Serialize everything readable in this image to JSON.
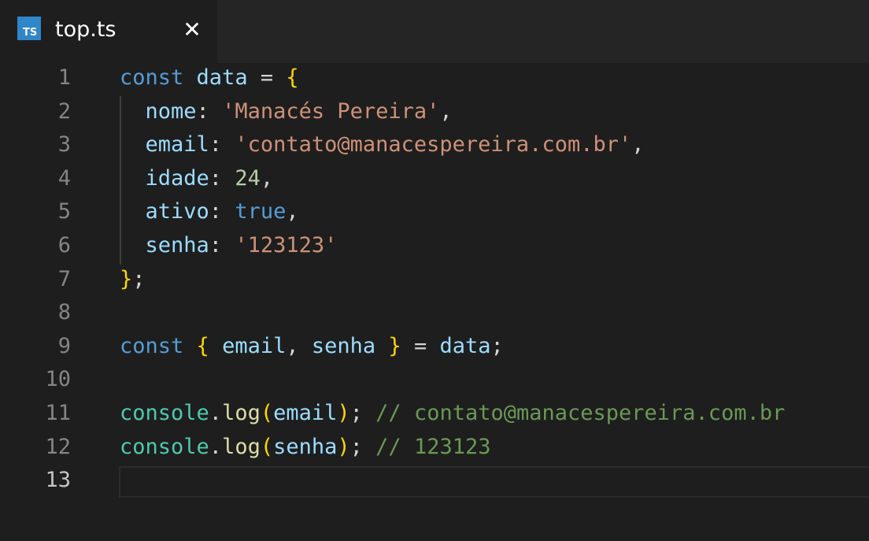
{
  "tab": {
    "icon_text": "TS",
    "title": "top.ts",
    "close_symbol": "✕"
  },
  "editor": {
    "active_line": 13,
    "lines": [
      {
        "number": "1",
        "tokens": [
          {
            "t": "kw",
            "v": "const"
          },
          {
            "t": "pun",
            "v": " "
          },
          {
            "t": "var",
            "v": "data"
          },
          {
            "t": "pun",
            "v": " = "
          },
          {
            "t": "br",
            "v": "{"
          }
        ]
      },
      {
        "number": "2",
        "tokens": [
          {
            "t": "pun",
            "v": "  "
          },
          {
            "t": "var",
            "v": "nome"
          },
          {
            "t": "pun",
            "v": ": "
          },
          {
            "t": "str",
            "v": "'Manacés Pereira'"
          },
          {
            "t": "pun",
            "v": ","
          }
        ]
      },
      {
        "number": "3",
        "tokens": [
          {
            "t": "pun",
            "v": "  "
          },
          {
            "t": "var",
            "v": "email"
          },
          {
            "t": "pun",
            "v": ": "
          },
          {
            "t": "str",
            "v": "'contato@manacespereira.com.br'"
          },
          {
            "t": "pun",
            "v": ","
          }
        ]
      },
      {
        "number": "4",
        "tokens": [
          {
            "t": "pun",
            "v": "  "
          },
          {
            "t": "var",
            "v": "idade"
          },
          {
            "t": "pun",
            "v": ": "
          },
          {
            "t": "num",
            "v": "24"
          },
          {
            "t": "pun",
            "v": ","
          }
        ]
      },
      {
        "number": "5",
        "tokens": [
          {
            "t": "pun",
            "v": "  "
          },
          {
            "t": "var",
            "v": "ativo"
          },
          {
            "t": "pun",
            "v": ": "
          },
          {
            "t": "kw",
            "v": "true"
          },
          {
            "t": "pun",
            "v": ","
          }
        ]
      },
      {
        "number": "6",
        "tokens": [
          {
            "t": "pun",
            "v": "  "
          },
          {
            "t": "var",
            "v": "senha"
          },
          {
            "t": "pun",
            "v": ": "
          },
          {
            "t": "str",
            "v": "'123123'"
          }
        ]
      },
      {
        "number": "7",
        "tokens": [
          {
            "t": "br",
            "v": "}"
          },
          {
            "t": "pun",
            "v": ";"
          }
        ]
      },
      {
        "number": "8",
        "tokens": []
      },
      {
        "number": "9",
        "tokens": [
          {
            "t": "kw",
            "v": "const"
          },
          {
            "t": "pun",
            "v": " "
          },
          {
            "t": "br",
            "v": "{"
          },
          {
            "t": "pun",
            "v": " "
          },
          {
            "t": "var",
            "v": "email"
          },
          {
            "t": "pun",
            "v": ", "
          },
          {
            "t": "var",
            "v": "senha"
          },
          {
            "t": "pun",
            "v": " "
          },
          {
            "t": "br",
            "v": "}"
          },
          {
            "t": "pun",
            "v": " = "
          },
          {
            "t": "var",
            "v": "data"
          },
          {
            "t": "pun",
            "v": ";"
          }
        ]
      },
      {
        "number": "10",
        "tokens": []
      },
      {
        "number": "11",
        "tokens": [
          {
            "t": "cls",
            "v": "console"
          },
          {
            "t": "pun",
            "v": "."
          },
          {
            "t": "fn",
            "v": "log"
          },
          {
            "t": "br",
            "v": "("
          },
          {
            "t": "var",
            "v": "email"
          },
          {
            "t": "br",
            "v": ")"
          },
          {
            "t": "pun",
            "v": "; "
          },
          {
            "t": "cmt",
            "v": "// contato@manacespereira.com.br"
          }
        ]
      },
      {
        "number": "12",
        "tokens": [
          {
            "t": "cls",
            "v": "console"
          },
          {
            "t": "pun",
            "v": "."
          },
          {
            "t": "fn",
            "v": "log"
          },
          {
            "t": "br",
            "v": "("
          },
          {
            "t": "var",
            "v": "senha"
          },
          {
            "t": "br",
            "v": ")"
          },
          {
            "t": "pun",
            "v": "; "
          },
          {
            "t": "cmt",
            "v": "// 123123"
          }
        ]
      },
      {
        "number": "13",
        "tokens": []
      }
    ]
  }
}
